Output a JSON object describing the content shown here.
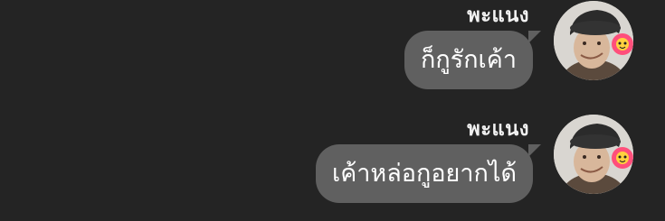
{
  "messages": [
    {
      "sender": "พะแนง",
      "text": "ก็กูรักเค้า",
      "avatar_icon": "user-avatar-icon"
    },
    {
      "sender": "พะแนง",
      "text": "เค้าหล่อกูอยากได้",
      "avatar_icon": "user-avatar-icon"
    }
  ],
  "colors": {
    "background": "#242424",
    "bubble": "#606060",
    "text": "#ffffff"
  }
}
